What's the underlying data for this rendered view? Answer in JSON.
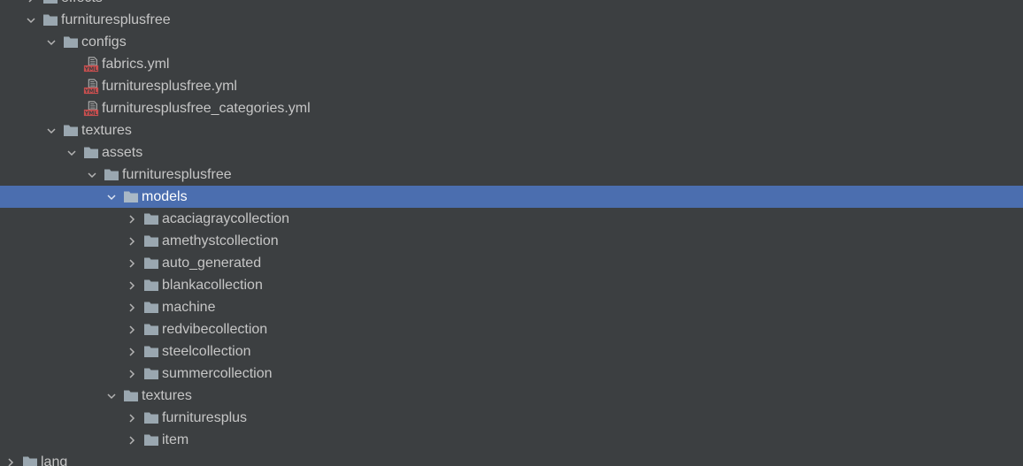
{
  "colors": {
    "background": "#3c3f41",
    "selection": "#4b6eaf",
    "text": "#c6c6c6",
    "folder": "#9aa7b0",
    "yml_badge": "#c94f4f"
  },
  "tree": {
    "items": [
      {
        "label": "effects",
        "icon": "folder-icon",
        "state": "collapsed"
      },
      {
        "label": "furnituresplusfree",
        "icon": "folder-icon",
        "state": "expanded"
      },
      {
        "label": "configs",
        "icon": "folder-icon",
        "state": "expanded"
      },
      {
        "label": "fabrics.yml",
        "icon": "yml-file-icon",
        "state": "leaf"
      },
      {
        "label": "furnituresplusfree.yml",
        "icon": "yml-file-icon",
        "state": "leaf"
      },
      {
        "label": "furnituresplusfree_categories.yml",
        "icon": "yml-file-icon",
        "state": "leaf"
      },
      {
        "label": "textures",
        "icon": "folder-icon",
        "state": "expanded"
      },
      {
        "label": "assets",
        "icon": "folder-icon",
        "state": "expanded"
      },
      {
        "label": "furnituresplusfree",
        "icon": "folder-icon",
        "state": "expanded"
      },
      {
        "label": "models",
        "icon": "folder-icon",
        "state": "expanded",
        "selected": true
      },
      {
        "label": "acaciagraycollection",
        "icon": "folder-icon",
        "state": "collapsed"
      },
      {
        "label": "amethystcollection",
        "icon": "folder-icon",
        "state": "collapsed"
      },
      {
        "label": "auto_generated",
        "icon": "folder-icon",
        "state": "collapsed"
      },
      {
        "label": "blankacollection",
        "icon": "folder-icon",
        "state": "collapsed"
      },
      {
        "label": "machine",
        "icon": "folder-icon",
        "state": "collapsed"
      },
      {
        "label": "redvibecollection",
        "icon": "folder-icon",
        "state": "collapsed"
      },
      {
        "label": "steelcollection",
        "icon": "folder-icon",
        "state": "collapsed"
      },
      {
        "label": "summercollection",
        "icon": "folder-icon",
        "state": "collapsed"
      },
      {
        "label": "textures",
        "icon": "folder-icon",
        "state": "expanded"
      },
      {
        "label": "furnituresplus",
        "icon": "folder-icon",
        "state": "collapsed"
      },
      {
        "label": "item",
        "icon": "folder-icon",
        "state": "collapsed"
      },
      {
        "label": "lang",
        "icon": "folder-icon",
        "state": "collapsed"
      }
    ]
  }
}
